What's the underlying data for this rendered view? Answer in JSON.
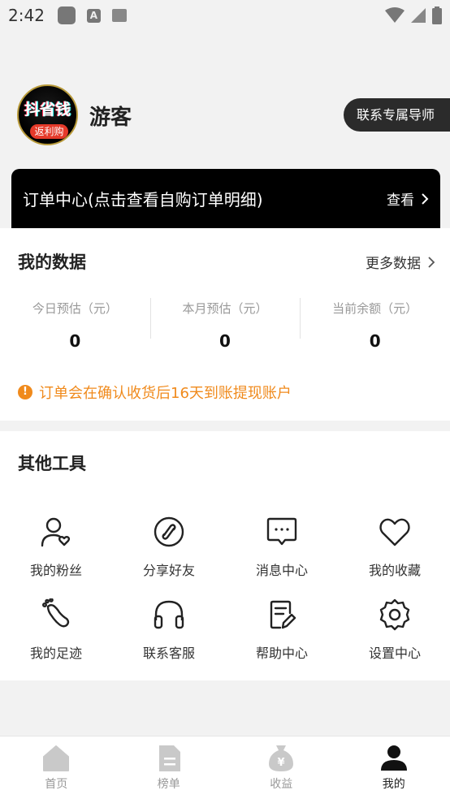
{
  "status_bar": {
    "time": "2:42",
    "a_icon": "A"
  },
  "profile": {
    "avatar_line1": "抖省钱",
    "avatar_line2": "返利购",
    "name": "游客",
    "mentor_button": "联系专属导师"
  },
  "order_bar": {
    "title": "订单中心(点击查看自购订单明细)",
    "view": "查看"
  },
  "my_data": {
    "title": "我的数据",
    "more": "更多数据",
    "stats": [
      {
        "label": "今日预估（元）",
        "value": "0"
      },
      {
        "label": "本月预估（元）",
        "value": "0"
      },
      {
        "label": "当前余额（元）",
        "value": "0"
      }
    ],
    "notice_icon": "!",
    "notice": "订单会在确认收货后16天到账提现账户"
  },
  "tools": {
    "title": "其他工具",
    "items": [
      {
        "label": "我的粉丝",
        "icon": "user-heart-icon"
      },
      {
        "label": "分享好友",
        "icon": "share-link-icon"
      },
      {
        "label": "消息中心",
        "icon": "message-icon"
      },
      {
        "label": "我的收藏",
        "icon": "heart-icon"
      },
      {
        "label": "我的足迹",
        "icon": "footprint-icon"
      },
      {
        "label": "联系客服",
        "icon": "headset-icon"
      },
      {
        "label": "帮助中心",
        "icon": "help-doc-icon"
      },
      {
        "label": "设置中心",
        "icon": "settings-gear-icon"
      }
    ]
  },
  "bottom_nav": {
    "items": [
      {
        "label": "首页",
        "icon": "home-icon"
      },
      {
        "label": "榜单",
        "icon": "list-doc-icon"
      },
      {
        "label": "收益",
        "icon": "money-bag-icon"
      },
      {
        "label": "我的",
        "icon": "person-icon"
      }
    ],
    "active_index": 3
  },
  "colors": {
    "accent_orange": "#f08a1c",
    "order_bar_bg": "#000000",
    "mentor_button_bg": "#2b2b2b"
  }
}
